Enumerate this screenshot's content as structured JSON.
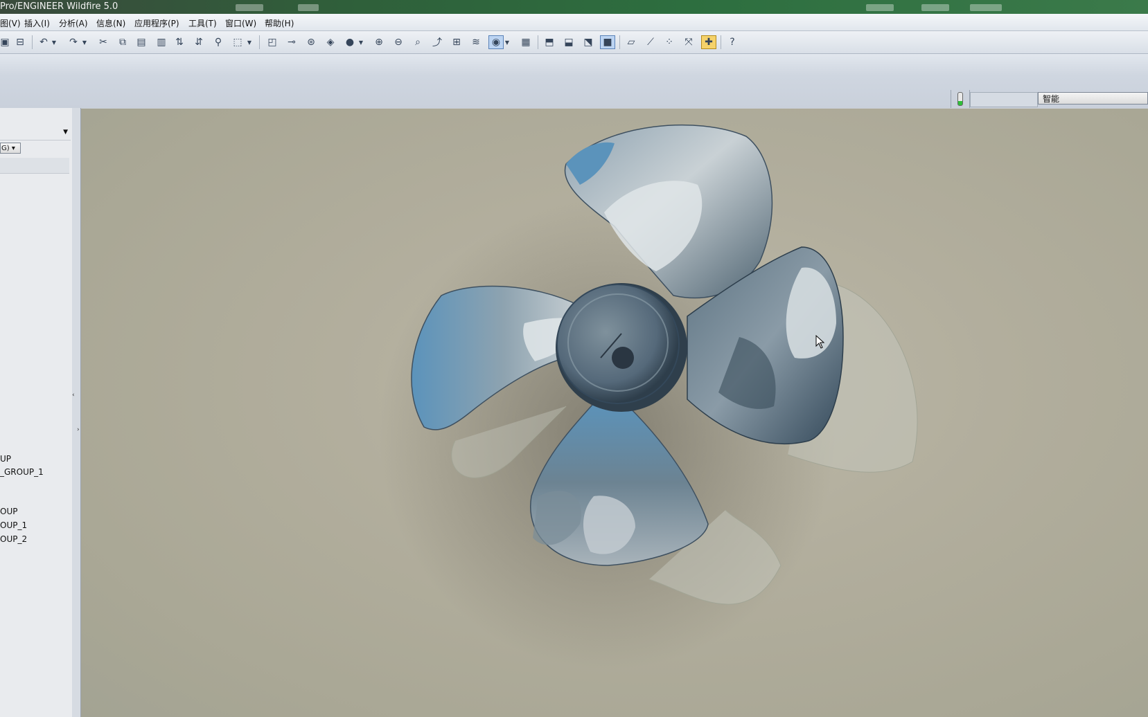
{
  "window": {
    "title": "Pro/ENGINEER Wildfire 5.0"
  },
  "menubar": {
    "items": [
      "图(V)",
      "插入(I)",
      "分析(A)",
      "信息(N)",
      "应用程序(P)",
      "工具(T)",
      "窗口(W)",
      "帮助(H)"
    ]
  },
  "toolbar": {
    "icons": [
      "open-icon",
      "save-icon",
      "undo-icon",
      "redo-icon",
      "cut-icon",
      "copy-icon",
      "paste-icon",
      "paste-special-icon",
      "regenerate-icon",
      "regen-manager-icon",
      "find-icon",
      "select-box-icon",
      "datum-display-icon",
      "datum-point-icon",
      "datum-csys-icon",
      "datum-plane-icon",
      "shading-icon",
      "zoom-in-icon",
      "zoom-out-icon",
      "refit-icon",
      "reorient-icon",
      "saved-views-icon",
      "layers-icon",
      "appearance-icon",
      "model-display-icon",
      "wireframe-icon",
      "hidden-line-icon",
      "no-hidden-icon",
      "shaded-icon",
      "plane-display-icon",
      "axis-display-icon",
      "point-display-icon",
      "csys-display-icon",
      "spin-center-icon",
      "context-help-icon"
    ]
  },
  "statusbar": {
    "filter_value": "智能"
  },
  "left_panel": {
    "combo_label": "G)",
    "tree_items": [
      "UP",
      "_GROUP_1",
      "OUP",
      "OUP_1",
      "OUP_2"
    ]
  },
  "colors": {
    "viewport_bg": "#b2ae9d",
    "blade_base": "#5f7482",
    "blade_highlight": "#c7cfd3",
    "blade_blue": "#5b93bb",
    "titlebar": "#2d6e3f"
  }
}
